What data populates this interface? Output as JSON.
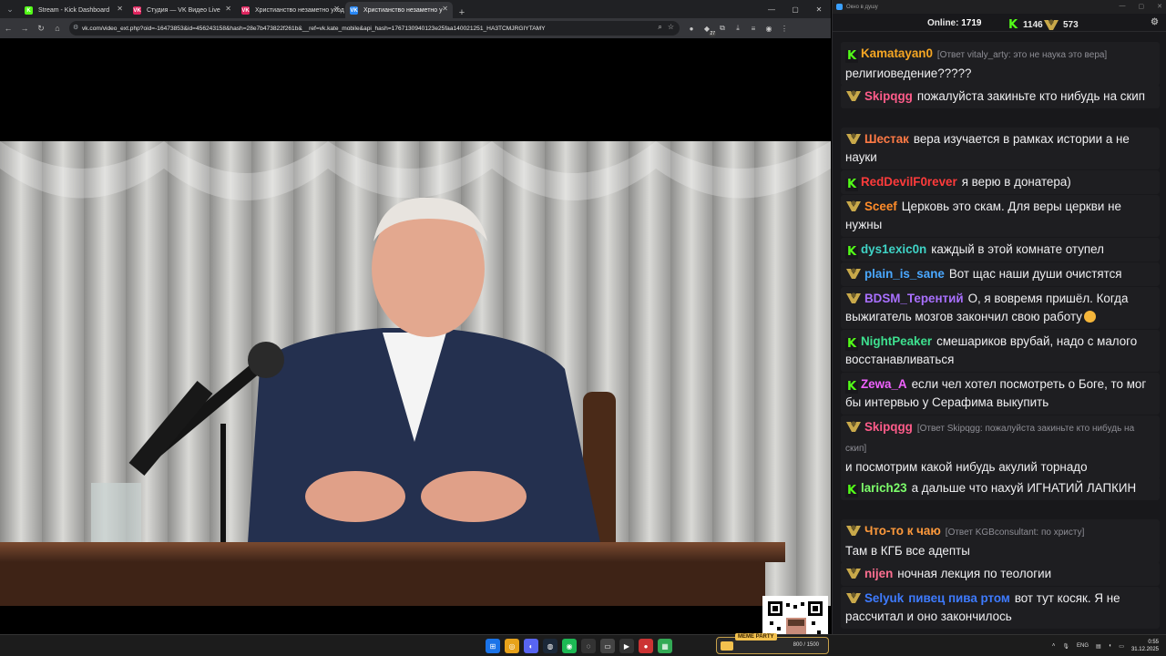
{
  "browser": {
    "tabs": [
      {
        "label": "Stream - Kick Dashboard",
        "favicon": "K",
        "color": "#53fc18",
        "active": false
      },
      {
        "label": "Студия — VK Видео Live",
        "favicon": "VK",
        "color": "#e0245e",
        "active": false
      },
      {
        "label": "Христианство незаметно уход",
        "favicon": "VK",
        "color": "#e0245e",
        "active": false
      },
      {
        "label": "Христианство незаметно у",
        "favicon": "VK",
        "color": "#2787f5",
        "active": true
      }
    ],
    "new_tab": "+",
    "url": "vk.com/video_ext.php?oid=-16473853&id=456243158&hash=28e7b473822f261b&__ref=vk.kate_mobile&api_hash=1767130940123e25faa140021251_HA3TCMJRGIYTAMY"
  },
  "chat": {
    "window_title": "Окно в душу",
    "online_label": "Online:",
    "online_count": "1719",
    "kick_count": "1146",
    "vk_count": "573",
    "messages": [
      {
        "platform": "kick",
        "user": "Kamatayan0",
        "color": "#f5a623",
        "reply": "[Ответ vitaly_arty: это не наука это вера]",
        "text": "религиоведение?????"
      },
      {
        "platform": "vk",
        "user": "Skipqgg",
        "color": "#ff5c8a",
        "reply": "",
        "text": "пожалуйста закиньте кто нибудь на скип"
      },
      {
        "platform": "vk",
        "user": "Шестак",
        "color": "#ff7a45",
        "reply": "",
        "text": "вера изучается в рамках истории а не науки"
      },
      {
        "platform": "kick",
        "user": "RedDevilF0rever",
        "color": "#ff3b3b",
        "reply": "",
        "text": "я верю в донатера)"
      },
      {
        "platform": "vk",
        "user": "Sceef",
        "color": "#ff8c2a",
        "reply": "",
        "text": "Церковь это скам. Для веры церкви не нужны"
      },
      {
        "platform": "kick",
        "user": "dys1exic0n",
        "color": "#3fd3c6",
        "reply": "",
        "text": "каждый в этой комнате отупел"
      },
      {
        "platform": "vk",
        "user": "plain_is_sane",
        "color": "#4aa8ff",
        "reply": "",
        "text": "Вот щас наши души очистятся"
      },
      {
        "platform": "vk",
        "user": "BDSM_Терентий",
        "color": "#a970ff",
        "reply": "",
        "text": "О, я вовремя пришёл. Когда выжигатель мозгов закончил свою работу"
      },
      {
        "platform": "kick",
        "user": "NightPeaker",
        "color": "#3ee08f",
        "reply": "",
        "text": "смешариков врубай, надо с малого восстанавливаться"
      },
      {
        "platform": "kick",
        "user": "Zewa_A",
        "color": "#f062ff",
        "reply": "",
        "text": "если чел хотел посмотреть о Боге, то мог бы интервью у Серафима выкупить"
      },
      {
        "platform": "vk",
        "user": "Skipqgg",
        "color": "#ff5c8a",
        "reply": "[Ответ Skipqgg: пожалуйста закиньте кто нибудь на скип]",
        "text": "и посмотрим какой нибудь акулий торнадо"
      },
      {
        "platform": "kick",
        "user": "larich23",
        "color": "#7dff6b",
        "reply": "",
        "text": "а дальше что нахуй ИГНАТИЙ ЛАПКИН"
      },
      {
        "platform": "vk",
        "user": "Что-то к чаю",
        "color": "#ff9a3c",
        "reply": "[Ответ KGBconsultant: по христу]",
        "text": "Там в КГБ все адепты"
      },
      {
        "platform": "vk",
        "user": "nijen",
        "color": "#ff6f91",
        "reply": "",
        "text": "ночная лекция по теологии"
      },
      {
        "platform": "vk",
        "user": "Selyuk",
        "color": "#3e7bff",
        "reply": "",
        "text": "вот тут косяк. Я не рассчитал и оно закончилось",
        "user_suffix": "пивец пива ртом"
      }
    ]
  },
  "taskbar": {
    "widget_label": "MEME PARTY",
    "widget_value": "800 / 1500",
    "lang": "ENG",
    "time": "0:55",
    "date": "31.12.2025"
  }
}
